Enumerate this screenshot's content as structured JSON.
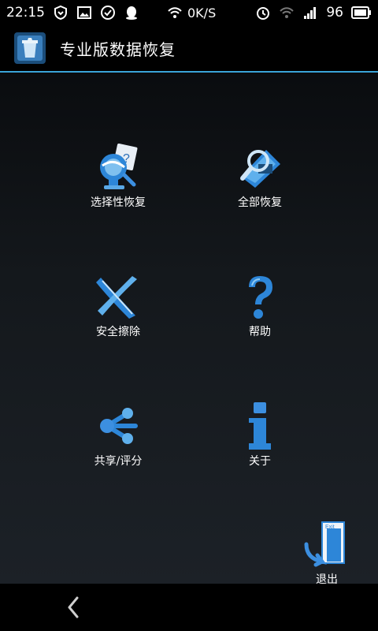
{
  "statusbar": {
    "time": "22:15",
    "network_speed": "0K/S",
    "battery": "96"
  },
  "appbar": {
    "title": "专业版数据恢复"
  },
  "menu": [
    {
      "label": "选择性恢复",
      "icon": "selective-restore-icon"
    },
    {
      "label": "全部恢复",
      "icon": "full-restore-icon"
    },
    {
      "label": "安全擦除",
      "icon": "secure-erase-icon"
    },
    {
      "label": "帮助",
      "icon": "help-icon"
    },
    {
      "label": "共享/评分",
      "icon": "share-icon"
    },
    {
      "label": "关于",
      "icon": "about-icon"
    }
  ],
  "exit": {
    "label": "退出",
    "sign_text": "Exit",
    "icon": "exit-door-icon"
  },
  "colors": {
    "accent": "#3aa4d8",
    "icon_blue": "#2d86d8"
  }
}
